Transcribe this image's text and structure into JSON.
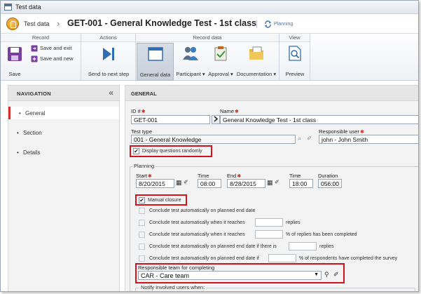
{
  "window": {
    "title": "Test data"
  },
  "header": {
    "crumb": "Test data",
    "separator": "›",
    "title": "GET-001 - General Knowledge Test - 1st class",
    "planning_label": "Planning"
  },
  "ribbon": {
    "groups": {
      "record": "Record",
      "actions": "Actions",
      "record_data": "Record data",
      "view": "View"
    },
    "save": "Save",
    "save_and_exit": "Save and exit",
    "save_and_new": "Save and new",
    "send_next_step": "Send to next step",
    "general_data": "General data",
    "participant": "Participant",
    "approval": "Approval",
    "documentation": "Documentation",
    "preview": "Preview"
  },
  "navigation": {
    "title": "NAVIGATION",
    "collapse": "«",
    "items": [
      {
        "label": "General"
      },
      {
        "label": "Section"
      },
      {
        "label": "Details"
      }
    ]
  },
  "form": {
    "section_title": "GENERAL",
    "id_label": "ID #",
    "id_value": "GET-001",
    "name_label": "Name",
    "name_value": "General Knowledge Test - 1st class",
    "test_type_label": "Test type",
    "test_type_value": "001 - General Knowledge",
    "responsible_label": "Responsible user",
    "responsible_value": "john - John Smith",
    "display_random": "Display questions randomly",
    "planning_label": "Planning",
    "start_label": "Start",
    "start_value": "8/20/2015",
    "time_label": "Time",
    "start_time": "08:00",
    "end_label": "End",
    "end_value": "8/28/2015",
    "end_time_label": "Time",
    "end_time": "18:00",
    "duration_label": "Duration",
    "duration_value": "056:00",
    "manual_closure": "Manual closure",
    "options": [
      "Conclude test automatically on planned end date",
      "Conclude test automatically when it reaches",
      "Conclude test automatically when it reaches",
      "Conclude test automatically on planned end date if there is",
      "Conclude test automatically on planned end date if"
    ],
    "opt2_suffix": "replies",
    "opt3_suffix": "% of replies has been completed",
    "opt4_suffix": "replies",
    "opt5_suffix": "% of respondents have completed the survey",
    "responsible_team_label": "Responsible team for completing",
    "responsible_team_value": "CAR - Care team",
    "notify_label": "Notify involved users when:",
    "required_mark": "✱"
  }
}
